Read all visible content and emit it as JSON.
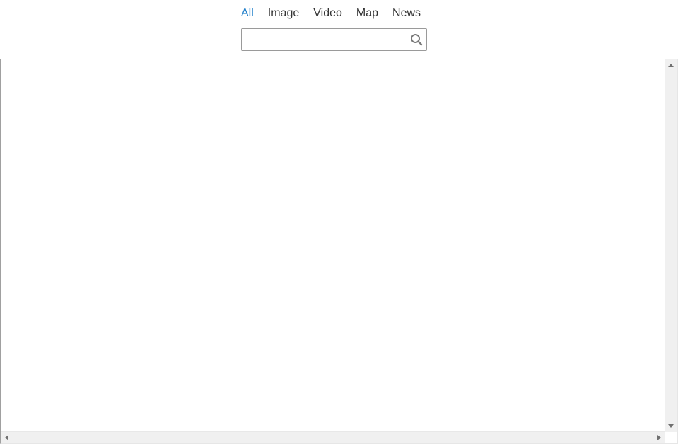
{
  "tabs": [
    {
      "label": "All",
      "active": true
    },
    {
      "label": "Image",
      "active": false
    },
    {
      "label": "Video",
      "active": false
    },
    {
      "label": "Map",
      "active": false
    },
    {
      "label": "News",
      "active": false
    }
  ],
  "search": {
    "value": "",
    "placeholder": "",
    "icon": "magnifier-icon"
  },
  "colors": {
    "active_tab": "#1f7ec9",
    "tab_text": "#333333",
    "border": "#9a9a9a",
    "scrollbar": "#f0f0f0"
  }
}
